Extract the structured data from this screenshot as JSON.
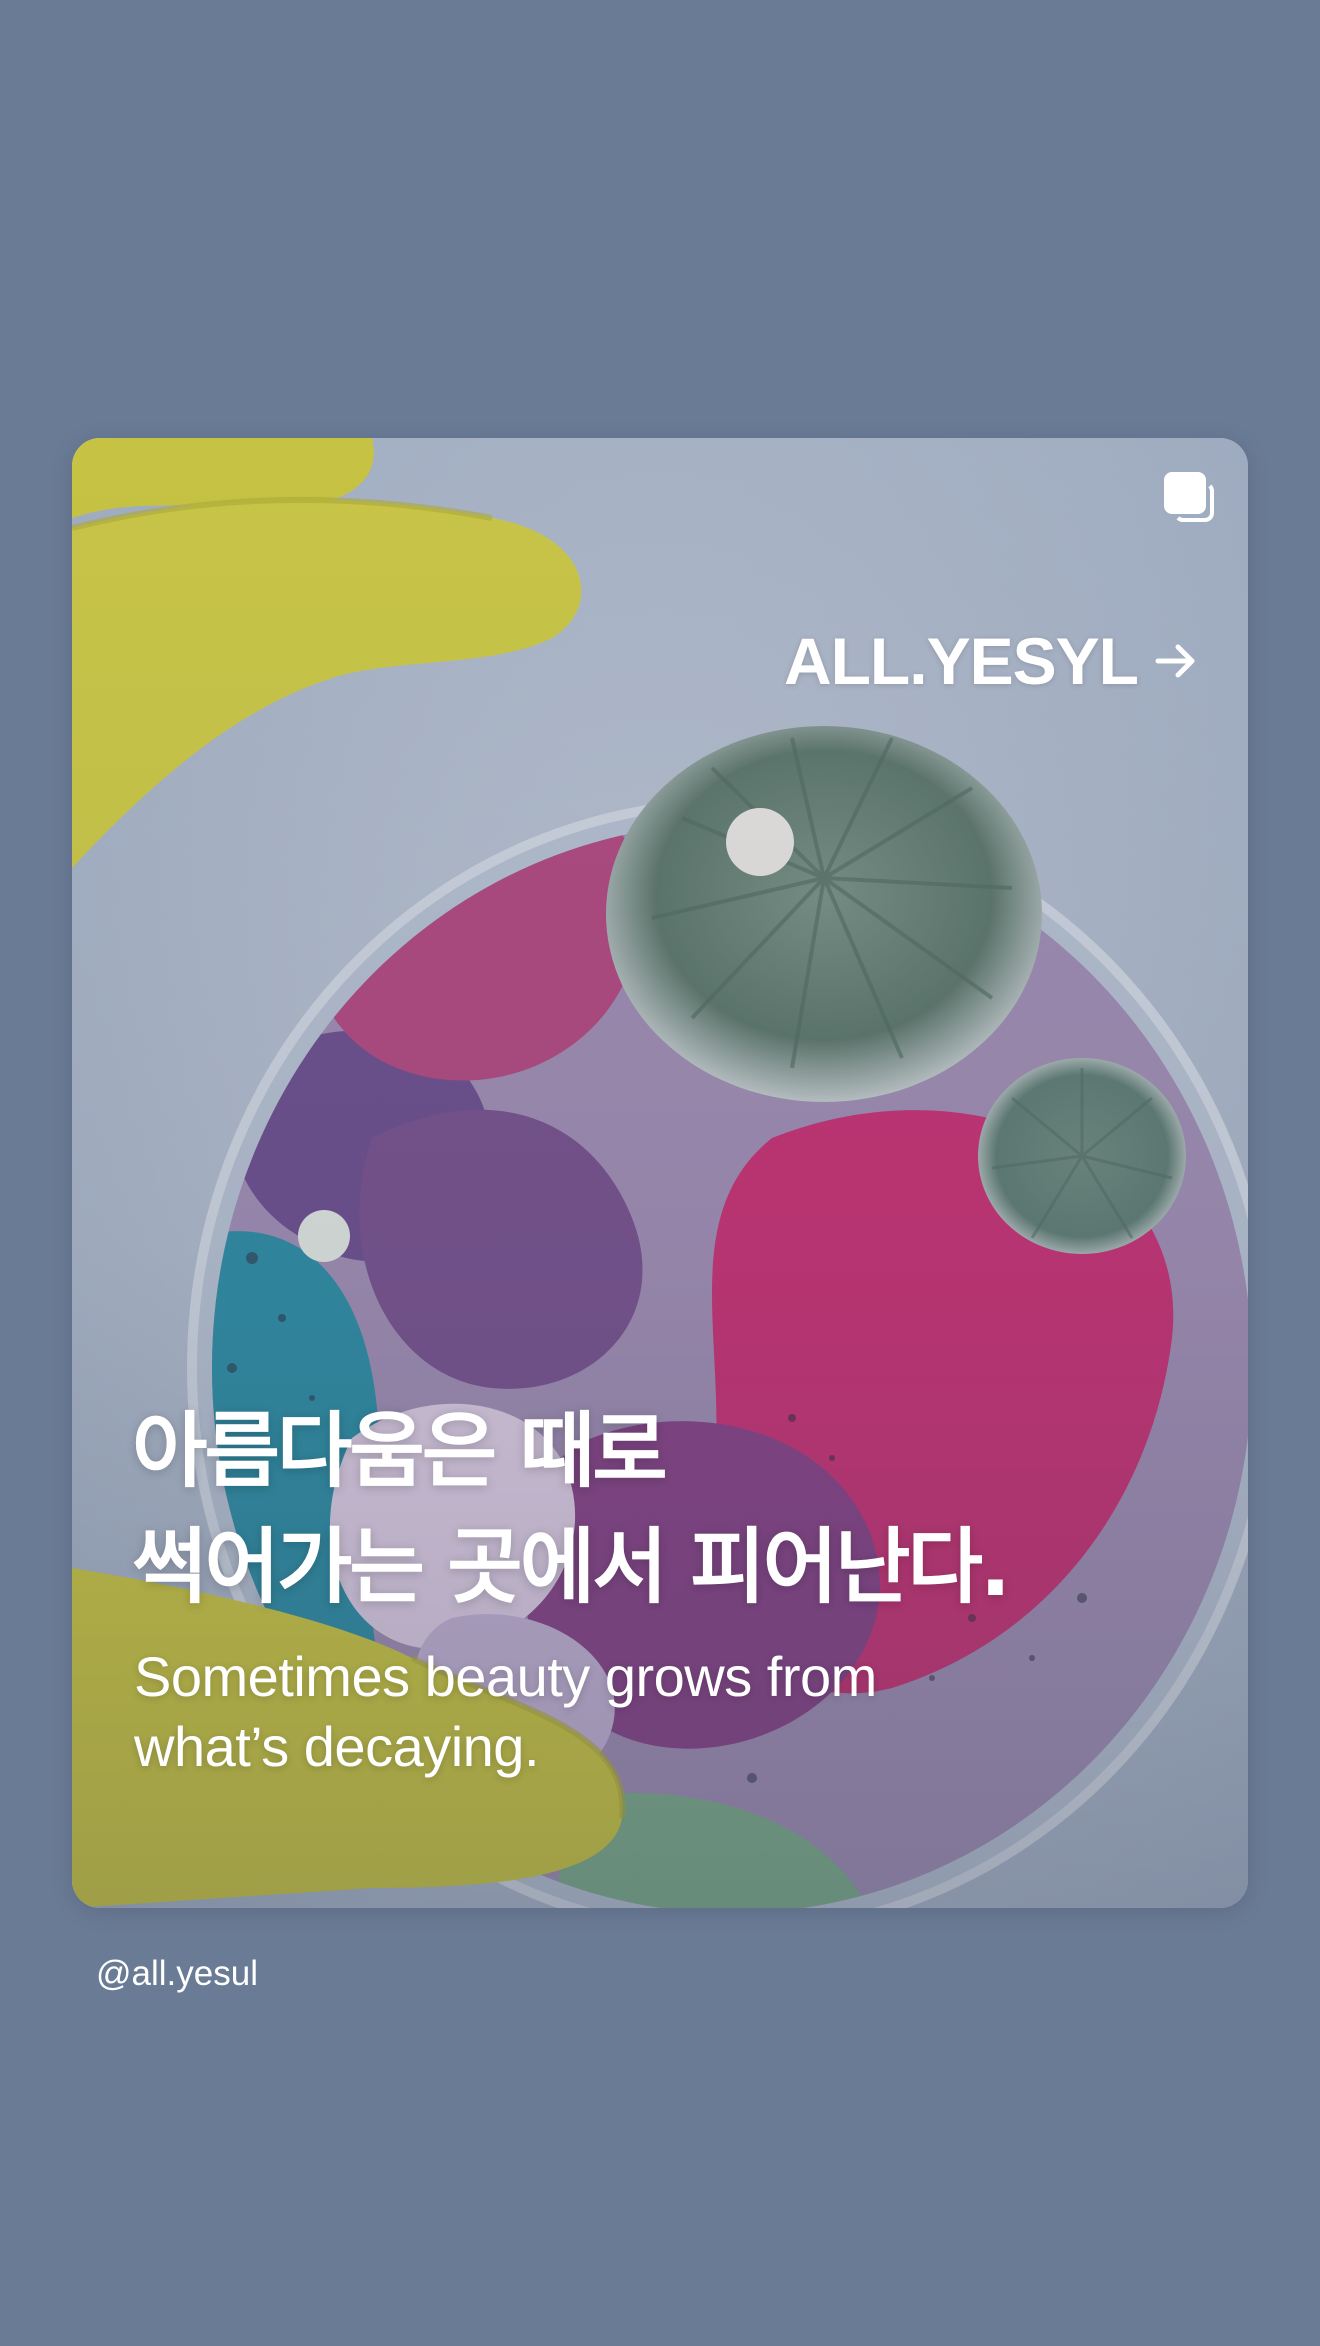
{
  "post": {
    "brand_link_label": "ALL.YESYL",
    "brand_link_icon": "arrow-right-icon",
    "multi_image_icon": "carousel-stack-icon",
    "headline_lines": [
      "아름다움은 때로",
      "썩어가는 곳에서 피어난다."
    ],
    "subline_lines": [
      "Sometimes beauty grows from",
      "what’s decaying."
    ]
  },
  "author": {
    "handle": "@all.yesul"
  },
  "colors": {
    "background": "#6a7b96",
    "text": "#ffffff",
    "glove": "#d6cf3c",
    "mold_green": "#5f7a6e",
    "agar_magenta": "#c02a6e",
    "agar_cyan": "#1d8aa3"
  }
}
